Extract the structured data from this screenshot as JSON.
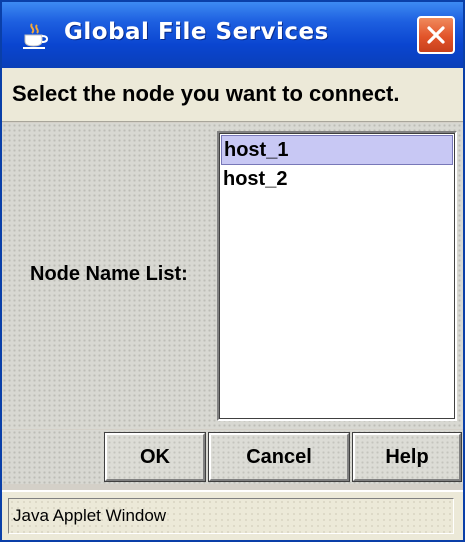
{
  "window": {
    "title": "Global File Services",
    "title_icon": "java-cup-icon",
    "close_icon": "close-icon",
    "accent_color": "#0a45d0",
    "close_color": "#e2542a"
  },
  "prompt": {
    "text": "Select the node you want to connect."
  },
  "node_list": {
    "label": "Node Name List:",
    "items": [
      {
        "label": "host_1",
        "selected": true
      },
      {
        "label": "host_2",
        "selected": false
      }
    ]
  },
  "buttons": {
    "ok": "OK",
    "cancel": "Cancel",
    "help": "Help"
  },
  "status": {
    "text": "Java Applet Window"
  }
}
